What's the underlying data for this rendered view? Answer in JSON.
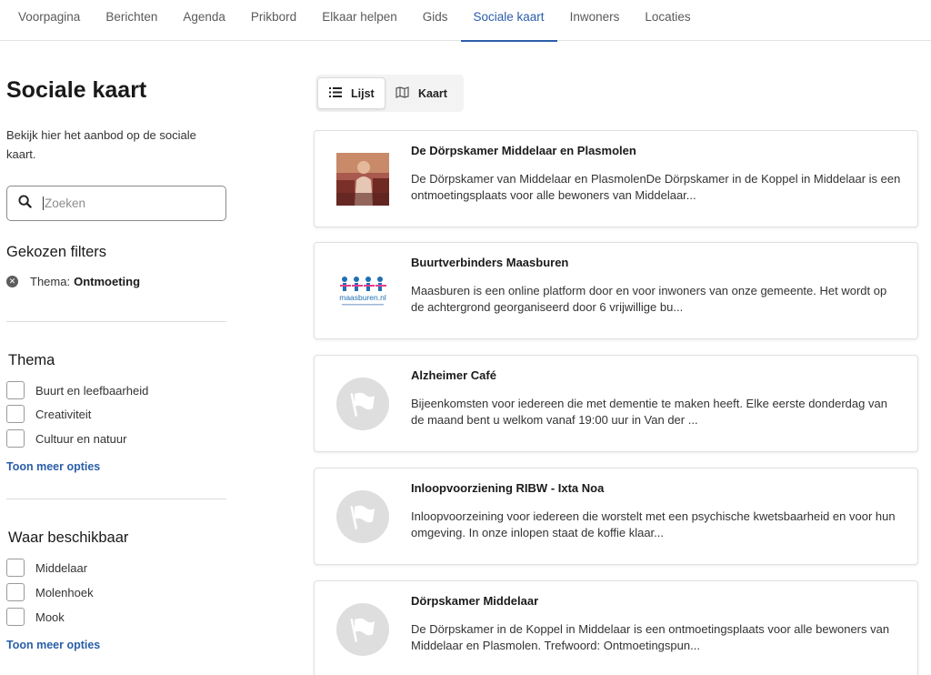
{
  "nav": {
    "tabs": [
      {
        "label": "Voorpagina"
      },
      {
        "label": "Berichten"
      },
      {
        "label": "Agenda"
      },
      {
        "label": "Prikbord"
      },
      {
        "label": "Elkaar helpen"
      },
      {
        "label": "Gids"
      },
      {
        "label": "Sociale kaart"
      },
      {
        "label": "Inwoners"
      },
      {
        "label": "Locaties"
      }
    ],
    "active": "Sociale kaart"
  },
  "sidebar": {
    "title": "Sociale kaart",
    "intro": "Bekijk hier het aanbod op de sociale kaart.",
    "search_placeholder": "Zoeken",
    "chosen_filters_title": "Gekozen filters",
    "chosen_filter": {
      "label": "Thema:",
      "value": "Ontmoeting"
    },
    "thema": {
      "title": "Thema",
      "options": [
        "Buurt en leefbaarheid",
        "Creativiteit",
        "Cultuur en natuur"
      ],
      "more": "Toon meer opties"
    },
    "waar": {
      "title": "Waar beschikbaar",
      "options": [
        "Middelaar",
        "Molenhoek",
        "Mook"
      ],
      "more": "Toon meer opties"
    }
  },
  "view_toggle": {
    "list_label": "Lijst",
    "map_label": "Kaart",
    "selected": "Lijst"
  },
  "results": [
    {
      "title": "De Dörpskamer Middelaar en Plasmolen",
      "desc": "De Dörpskamer van Middelaar en PlasmolenDe Dörpskamer in de Koppel in Middelaar is een ontmoetingsplaats voor alle bewoners van Middelaar...",
      "thumb": "photo"
    },
    {
      "title": "Buurtverbinders Maasburen",
      "desc": "Maasburen is een online platform door en voor inwoners van onze gemeente. Het wordt op de achtergrond georganiseerd door 6 vrijwillige bu...",
      "thumb": "logo",
      "logo_text": "maasburen.nl"
    },
    {
      "title": "Alzheimer Café",
      "desc": "Bijeenkomsten voor iedereen die met dementie te maken heeft. Elke eerste donderdag van de maand bent u welkom vanaf 19:00 uur in Van der ...",
      "thumb": "flag-icon"
    },
    {
      "title": "Inloopvoorziening RIBW - Ixta Noa",
      "desc": "Inloopvoorzeining voor iedereen die worstelt met een psychische kwetsbaarheid en voor hun omgeving. In onze inlopen staat de koffie klaar...",
      "thumb": "flag-icon"
    },
    {
      "title": "Dörpskamer Middelaar",
      "desc": "De Dörpskamer in de Koppel in Middelaar is een ontmoetingsplaats voor alle bewoners van Middelaar en Plasmolen. Trefwoord: Ontmoetingspun...",
      "thumb": "flag-icon"
    }
  ],
  "colors": {
    "accent": "#2a5ea8",
    "placeholder_bg": "#dedede"
  }
}
